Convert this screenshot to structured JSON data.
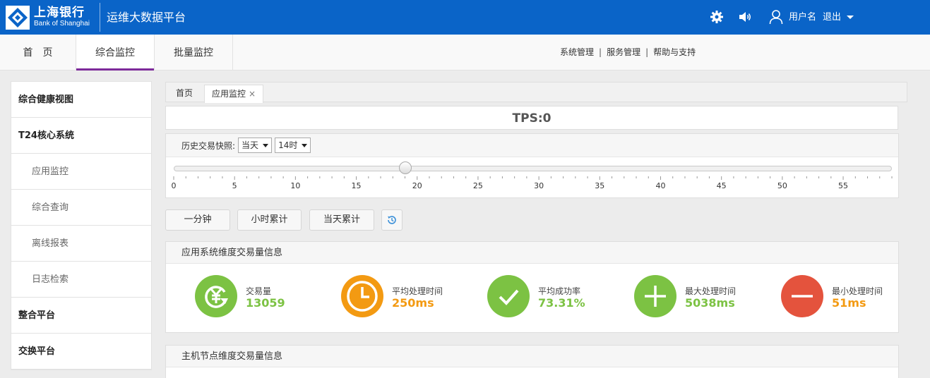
{
  "header": {
    "bank_name_cn": "上海银行",
    "bank_name_en": "Bank of Shanghai",
    "app_title": "运维大数据平台",
    "user_name": "用户名",
    "logout_label": "退出",
    "icons": [
      "gear-icon",
      "speaker-icon",
      "user-icon",
      "caret-down-icon"
    ]
  },
  "main_tabs": [
    {
      "label": "首　页"
    },
    {
      "label": "综合监控",
      "active": true
    },
    {
      "label": "批量监控"
    }
  ],
  "top_links": [
    "系统管理",
    "服务管理",
    "帮助与支持"
  ],
  "sidebar": {
    "items": [
      {
        "label": "综合健康视图",
        "type": "group"
      },
      {
        "label": "T24核心系统",
        "type": "group"
      },
      {
        "label": "应用监控",
        "type": "sub"
      },
      {
        "label": "综合查询",
        "type": "sub"
      },
      {
        "label": "离线报表",
        "type": "sub"
      },
      {
        "label": "日志检索",
        "type": "sub"
      },
      {
        "label": "整合平台",
        "type": "group"
      },
      {
        "label": "交换平台",
        "type": "group"
      }
    ]
  },
  "content_tabs": [
    {
      "label": "首页"
    },
    {
      "label": "应用监控",
      "active": true,
      "close": "×"
    }
  ],
  "tps": {
    "label": "TPS:0"
  },
  "history": {
    "label": "历史交易快照:",
    "day_select": "当天",
    "hour_select": "14时",
    "slider": {
      "min": 0,
      "max": 59,
      "value": 19
    },
    "tick_labels": [
      "0",
      "5",
      "10",
      "15",
      "20",
      "25",
      "30",
      "35",
      "40",
      "45",
      "50",
      "55"
    ]
  },
  "range_buttons": [
    "一分钟",
    "小时累计",
    "当天累计"
  ],
  "history_icon": "history-icon",
  "app_panel": {
    "title": "应用系统维度交易量信息",
    "metrics": [
      {
        "label": "交易量",
        "value": "13059",
        "color": "#7cc243",
        "value_color": "#7cc243",
        "icon": "yuan-refresh-icon"
      },
      {
        "label": "平均处理时间",
        "value": "250ms",
        "color": "#f39a12",
        "value_color": "#f39a12",
        "icon": "clock-icon"
      },
      {
        "label": "平均成功率",
        "value": "73.31%",
        "color": "#7cc243",
        "value_color": "#7cc243",
        "icon": "check-icon"
      },
      {
        "label": "最大处理时间",
        "value": "5038ms",
        "color": "#7cc243",
        "value_color": "#7cc243",
        "icon": "plus-icon"
      },
      {
        "label": "最小处理时间",
        "value": "51ms",
        "color": "#e4533d",
        "value_color": "#f39a12",
        "icon": "minus-icon"
      }
    ]
  },
  "host_panel": {
    "title": "主机节点维度交易量信息"
  }
}
